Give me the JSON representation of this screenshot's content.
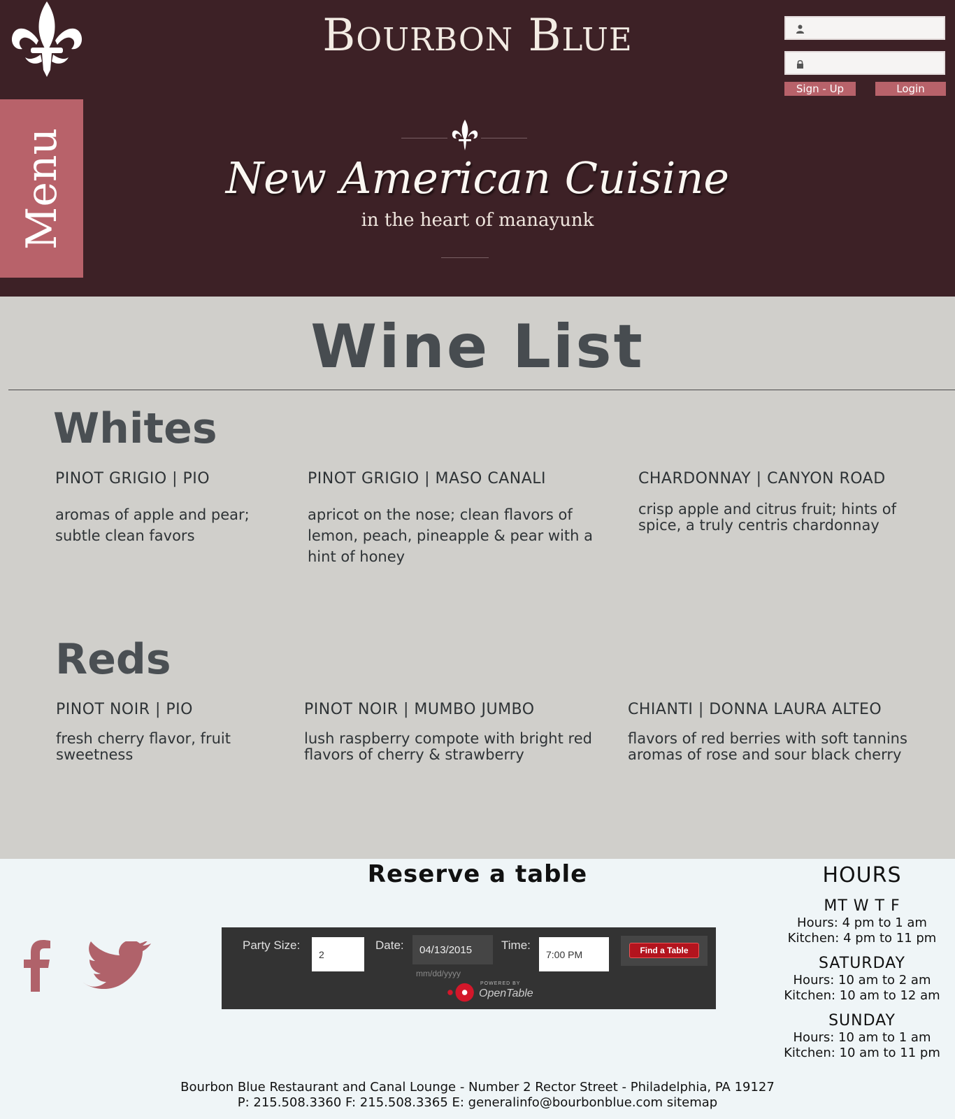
{
  "header": {
    "brand": "Bourbon Blue",
    "tagline": "New American Cuisine",
    "subtagline": "in the heart of manayunk",
    "menu_tab": "Menu",
    "login": {
      "signup_label": "Sign - Up",
      "login_label": "Login"
    }
  },
  "main": {
    "title": "Wine List",
    "sections": [
      {
        "title": "Whites",
        "wines": [
          {
            "name": "PINOT GRIGIO  |  PIO",
            "desc": "aromas of apple and pear; subtle clean favors"
          },
          {
            "name": "PINOT GRIGIO  |  MASO CANALI",
            "desc": "apricot on the nose; clean flavors of lemon, peach, pineapple & pear with a hint of honey"
          },
          {
            "name": "CHARDONNAY  |  CANYON ROAD",
            "desc": "crisp apple and citrus fruit; hints of spice, a truly centris chardonnay"
          }
        ]
      },
      {
        "title": "Reds",
        "wines": [
          {
            "name": "PINOT NOIR  |  PIO",
            "desc": "fresh cherry flavor, fruit sweetness"
          },
          {
            "name": "PINOT NOIR  |  MUMBO JUMBO",
            "desc": "lush raspberry compote with bright red flavors of cherry & strawberry"
          },
          {
            "name": "CHIANTI  |  DONNA LAURA ALTEO",
            "desc": "flavors of red berries with soft tannins aromas of rose and sour black cherry"
          }
        ]
      }
    ]
  },
  "footer": {
    "reserve_title": "Reserve a table",
    "opentable": {
      "party_label": "Party Size:",
      "party_value": "2",
      "date_label": "Date:",
      "date_value": "04/13/2015",
      "date_hint": "mm/dd/yyyy",
      "time_label": "Time:",
      "time_value": "7:00 PM",
      "find_label": "Find a Table",
      "powered_by": "POWERED BY",
      "brand": "OpenTable"
    },
    "hours": {
      "title": "HOURS",
      "blocks": [
        {
          "day": "MT W T F",
          "hours": "Hours: 4 pm to 1 am",
          "kitchen": "Kitchen: 4 pm to 11 pm"
        },
        {
          "day": "SATURDAY",
          "hours": "Hours: 10 am to 2 am",
          "kitchen": "Kitchen: 10 am to 12 am"
        },
        {
          "day": "SUNDAY",
          "hours": "Hours: 10 am to 1 am",
          "kitchen": "Kitchen: 10 am to 11 pm"
        }
      ]
    },
    "address_line": "Bourbon Blue Restaurant and Canal Lounge - Number 2 Rector Street - Philadelphia, PA 19127",
    "contact_line": "P: 215.508.3360 F: 215.508.3365 E: generalinfo@bourbonblue.com",
    "sitemap_label": "sitemap"
  },
  "colors": {
    "header_bg": "#3d2126",
    "accent_pink": "#b8626a",
    "content_bg": "#d0cfcb",
    "footer_bg": "#eff5f7"
  },
  "icons": [
    "fleur-de-lis-icon",
    "user-icon",
    "lock-icon",
    "facebook-icon",
    "twitter-icon",
    "opentable-icon"
  ]
}
